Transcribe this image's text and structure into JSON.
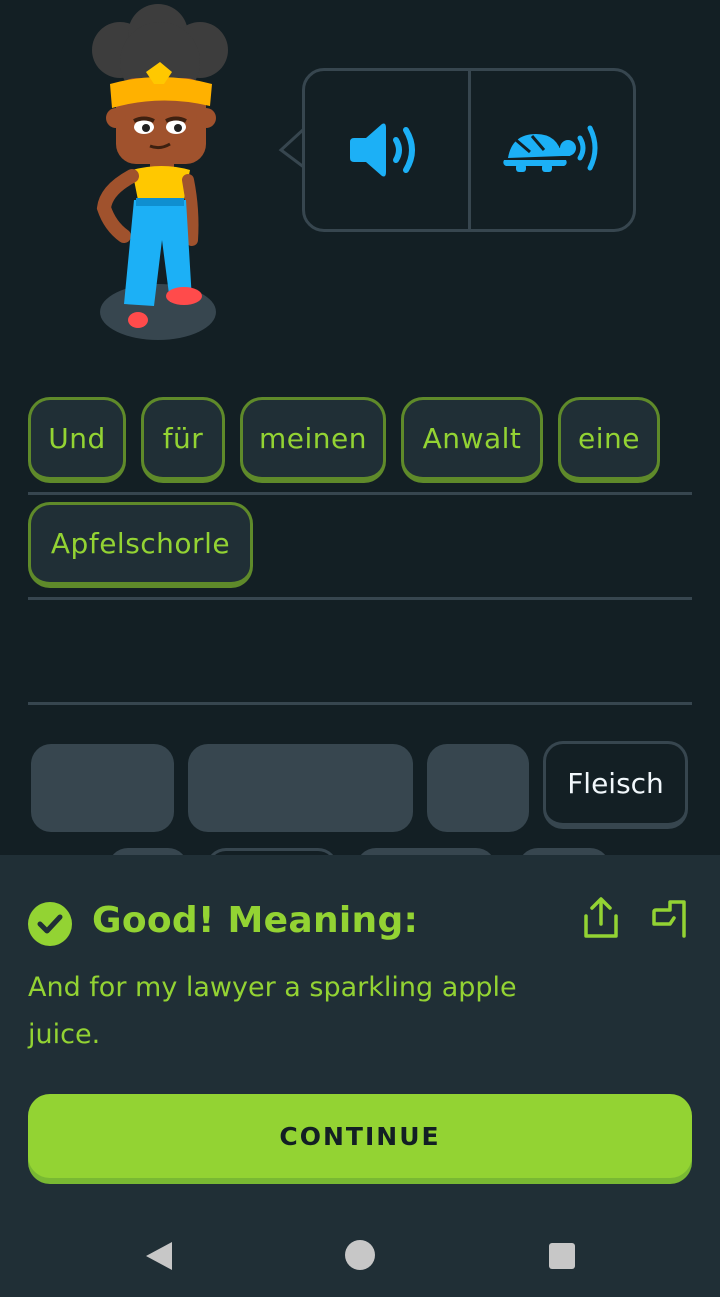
{
  "audio": {
    "normal_icon": "speaker-icon",
    "slow_icon": "turtle-speaker-icon"
  },
  "answer": {
    "words": [
      "Und",
      "für",
      "meinen",
      "Anwalt",
      "eine",
      "Apfelschorle"
    ]
  },
  "word_bank": {
    "visible_word": "Fleisch"
  },
  "feedback": {
    "title": "Good! Meaning:",
    "translation": "And for my lawyer a sparkling apple juice.",
    "continue_label": "CONTINUE"
  },
  "colors": {
    "background": "#131f24",
    "panel": "#202f36",
    "accent_green": "#93d333",
    "audio_blue": "#1cb0f6"
  }
}
